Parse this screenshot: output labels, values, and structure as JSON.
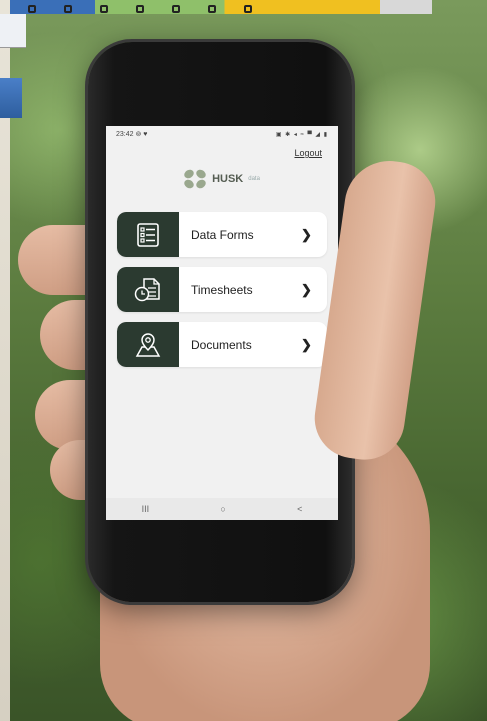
{
  "status_bar": {
    "time": "23:42",
    "left_icons": "⊚ ♥",
    "right_icons": "▣ ✱ ◂ ≈ ▀ ◢ ▮"
  },
  "header": {
    "logout_label": "Logout"
  },
  "logo": {
    "name": "HUSK",
    "suffix": "data"
  },
  "menu": {
    "items": [
      {
        "label": "Data Forms",
        "icon": "form-list-icon",
        "chevron": "❯"
      },
      {
        "label": "Timesheets",
        "icon": "timesheet-clock-icon",
        "chevron": "❯"
      },
      {
        "label": "Documents",
        "icon": "map-pin-document-icon",
        "chevron": "❯"
      }
    ]
  },
  "nav_bar": {
    "recents": "III",
    "home": "○",
    "back": "<"
  },
  "colors": {
    "menu_icon_bg": "#2b3a30",
    "screen_bg": "#f1f1f1",
    "logo_green": "#9aa88e"
  }
}
